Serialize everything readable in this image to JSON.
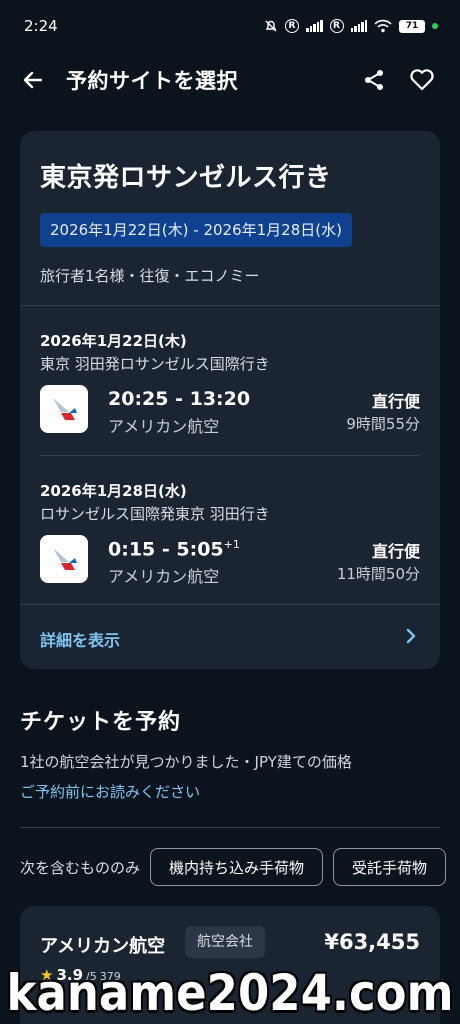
{
  "status_bar": {
    "time": "2:24",
    "battery": "71"
  },
  "header": {
    "title": "予約サイトを選択"
  },
  "trip": {
    "route_title": "東京発ロサンゼルス行き",
    "dates": "2026年1月22日(木) - 2026年1月28日(水)",
    "traveler_info": "旅行者1名様・往復・エコノミー",
    "segments": [
      {
        "date": "2026年1月22日(木)",
        "route": "東京 羽田発ロサンゼルス国際行き",
        "time": "20:25 - 13:20",
        "time_suffix": "",
        "carrier": "アメリカン航空",
        "stops": "直行便",
        "duration": "9時間55分"
      },
      {
        "date": "2026年1月28日(水)",
        "route": "ロサンゼルス国際発東京 羽田行き",
        "time": "0:15 - 5:05",
        "time_suffix": "+1",
        "carrier": "アメリカン航空",
        "stops": "直行便",
        "duration": "11時間50分"
      }
    ],
    "details_label": "詳細を表示"
  },
  "booking": {
    "title": "チケットを予約",
    "subtitle": "1社の航空会社が見つかりました・JPY建ての価格",
    "notice_link": "ご予約前にお読みください",
    "filter_label": "次を含むもののみ",
    "filters": [
      "機内持ち込み手荷物",
      "受託手荷物"
    ]
  },
  "result": {
    "name": "アメリカン航空",
    "badge": "航空会社",
    "price": "¥63,455",
    "rating": "3.9",
    "rating_scale": "/5",
    "review_count": "379"
  },
  "watermark": "kaname2024.com",
  "colors": {
    "background": "#0b131d",
    "card": "#1b2431",
    "accent_link": "#7ec5f2",
    "date_badge": "#10418f"
  }
}
